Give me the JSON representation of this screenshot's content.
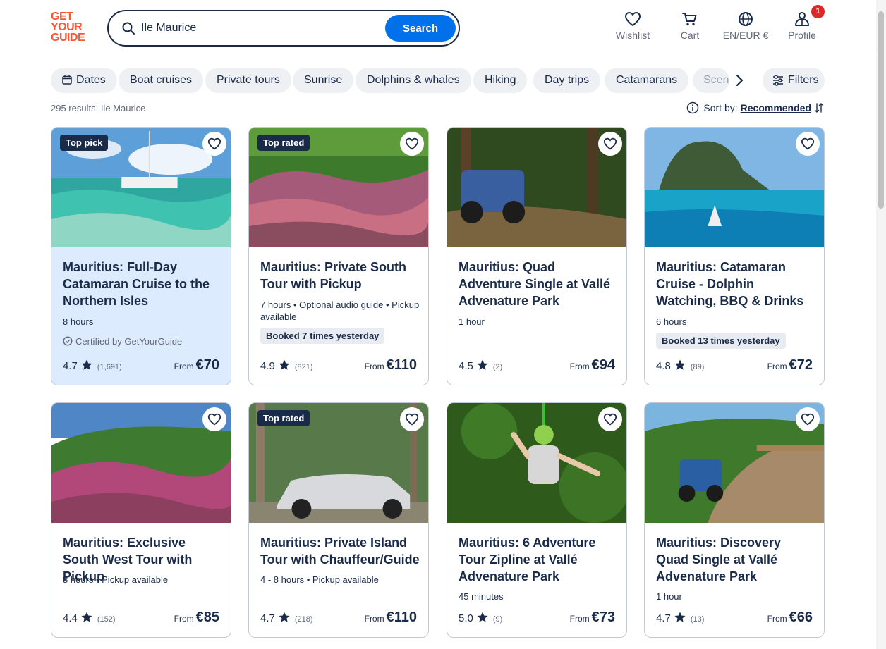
{
  "header": {
    "logo_lines": [
      "GET",
      "YOUR",
      "GUIDE"
    ],
    "search_value": "Ile Maurice",
    "search_button": "Search",
    "nav": {
      "wishlist": "Wishlist",
      "cart": "Cart",
      "language": "EN/EUR €",
      "profile": "Profile",
      "profile_badge": "1"
    }
  },
  "chips": [
    "Dates",
    "Boat cruises",
    "Private tours",
    "Sunrise",
    "Dolphins & whales",
    "Hiking",
    "Day trips",
    "Catamarans",
    "Scenic"
  ],
  "filters_label": "Filters",
  "results": {
    "count_text": "295 results: Ile Maurice",
    "sort_label": "Sort by:",
    "sort_value": "Recommended"
  },
  "cards": [
    {
      "tag": "Top pick",
      "title": "Mauritius: Full-Day Catamaran Cruise to the Northern Isles",
      "meta": "8 hours",
      "certified": "Certified by GetYourGuide",
      "booked": "",
      "rating": "4.7",
      "reviews": "(1,691)",
      "from": "From",
      "price": "€70"
    },
    {
      "tag": "Top rated",
      "title": "Mauritius: Private South Tour with Pickup",
      "meta": "7 hours • Optional audio guide • Pickup available",
      "certified": "",
      "booked": "Booked 7 times yesterday",
      "rating": "4.9",
      "reviews": "(821)",
      "from": "From",
      "price": "€110"
    },
    {
      "tag": "",
      "title": "Mauritius: Quad Adventure Single at Vallé Advenature Park",
      "meta": "1 hour",
      "certified": "",
      "booked": "",
      "rating": "4.5",
      "reviews": "(2)",
      "from": "From",
      "price": "€94"
    },
    {
      "tag": "",
      "title": "Mauritius: Catamaran Cruise - Dolphin Watching, BBQ & Drinks",
      "meta": "6 hours",
      "certified": "",
      "booked": "Booked 13 times yesterday",
      "rating": "4.8",
      "reviews": "(89)",
      "from": "From",
      "price": "€72"
    },
    {
      "tag": "",
      "title": "Mauritius: Exclusive South West Tour with Pickup",
      "meta": "8 hours • Pickup available",
      "certified": "",
      "booked": "",
      "rating": "4.4",
      "reviews": "(152)",
      "from": "From",
      "price": "€85"
    },
    {
      "tag": "Top rated",
      "title": "Mauritius: Private Island Tour with Chauffeur/Guide",
      "meta": "4 - 8 hours • Pickup available",
      "certified": "",
      "booked": "",
      "rating": "4.7",
      "reviews": "(218)",
      "from": "From",
      "price": "€110"
    },
    {
      "tag": "",
      "title": "Mauritius: 6 Adventure Tour Zipline at Vallé Advenature Park",
      "meta": "45 minutes",
      "certified": "",
      "booked": "",
      "rating": "5.0",
      "reviews": "(9)",
      "from": "From",
      "price": "€73"
    },
    {
      "tag": "",
      "title": "Mauritius: Discovery Quad Single at Vallé Advenature Park",
      "meta": "1 hour",
      "certified": "",
      "booked": "",
      "rating": "4.7",
      "reviews": "(13)",
      "from": "From",
      "price": "€66"
    }
  ],
  "colors": {
    "brand": "#ff5533",
    "primary": "#0071eb",
    "text": "#1a2b49",
    "highlight_card": "#dcebfd",
    "badge": "#dc2a2a"
  }
}
